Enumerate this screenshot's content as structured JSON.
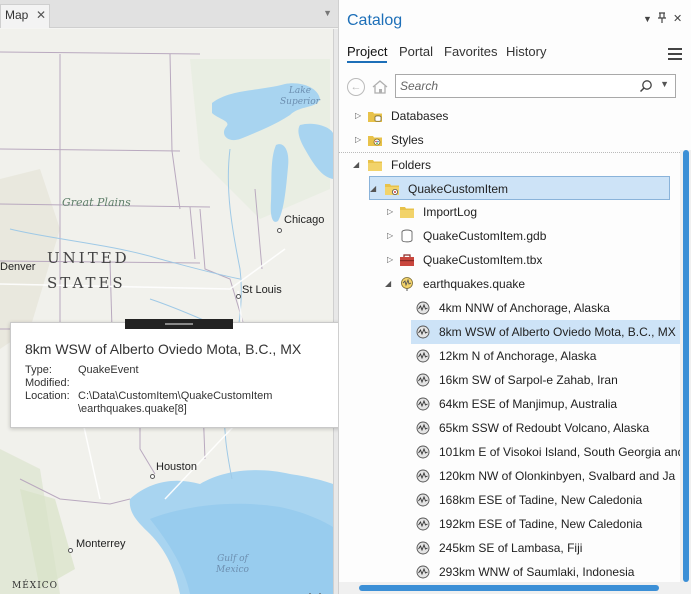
{
  "map": {
    "tab_label": "Map",
    "tab_close": "✕",
    "labels": {
      "lake_superior": "Lake\nSuperior",
      "great_plains": "Great Plains",
      "united": "UNITED",
      "states": "STATES",
      "chicago": "Chicago",
      "denver": "Denver",
      "st_louis": "St Louis",
      "houston": "Houston",
      "monterrey": "Monterrey",
      "gulf": "Gulf of\nMexico",
      "mexico": "MÉXICO"
    }
  },
  "popup": {
    "title": "8km WSW of Alberto Oviedo Mota, B.C., MX",
    "type_label": "Type:",
    "type_value": "QuakeEvent",
    "modified_label": "Modified:",
    "modified_value": "",
    "location_label": "Location:",
    "location_line1": "C:\\Data\\CustomItem\\QuakeCustomItem",
    "location_line2": "\\earthquakes.quake[8]"
  },
  "catalog": {
    "title": "Catalog",
    "header_controls": {
      "dropdown": "▼",
      "pin": "📌",
      "close": "✕"
    },
    "tabs": [
      "Project",
      "Portal",
      "Favorites",
      "History"
    ],
    "active_tab": "Project",
    "search_placeholder": "Search",
    "tree": {
      "databases": "Databases",
      "styles": "Styles",
      "folders": "Folders",
      "quake_custom_item": "QuakeCustomItem",
      "import_log": "ImportLog",
      "gdb": "QuakeCustomItem.gdb",
      "tbx": "QuakeCustomItem.tbx",
      "quake_file": "earthquakes.quake",
      "events": [
        "4km NNW of Anchorage, Alaska",
        "8km WSW of Alberto Oviedo Mota, B.C., MX",
        "12km N of Anchorage, Alaska",
        "16km SW of Sarpol-e Zahab, Iran",
        "64km ESE of Manjimup, Australia",
        "65km SSW of Redoubt Volcano, Alaska",
        "101km E of Visokoi Island, South Georgia and",
        "120km NW of Olonkinbyen, Svalbard and Ja",
        "168km ESE of Tadine, New Caledonia",
        "192km ESE of Tadine, New Caledonia",
        "245km SE of Lambasa, Fiji",
        "293km WNW of Saumlaki, Indonesia"
      ]
    },
    "colors": {
      "accent": "#1d6fb8",
      "selected": "#cde3f7",
      "folder": "#e8c24a",
      "scroll": "#3b8fd6"
    }
  }
}
